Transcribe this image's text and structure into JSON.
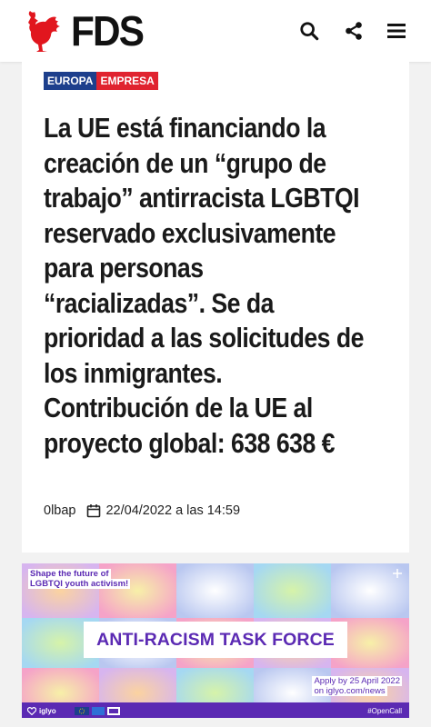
{
  "header": {
    "logo_text": "FDS",
    "icons": [
      "rooster-logo-icon",
      "search-icon",
      "share-icon",
      "menu-icon"
    ]
  },
  "article": {
    "tags": [
      "EUROPA",
      "EMPRESA"
    ],
    "headline_lines": [
      "La UE está financiando la",
      "creación de un “grupo de",
      "trabajo” antirracista LGBTQI",
      "reservado exclusivamente",
      "para personas",
      "“racializadas”. Se da",
      "prioridad a las solicitudes de",
      "los inmigrantes.",
      "Contribución de la UE al",
      "proyecto global: 638 638 €"
    ],
    "author": "0lbap",
    "date": "22/04/2022 a las 14:59"
  },
  "banner": {
    "top_left_lines": [
      "Shape the future of",
      "LGBTQI youth activism!"
    ],
    "title": "ANTI-RACISM TASK FORCE",
    "apply_lines": [
      "Apply by 25 April 2022",
      "on iglyo.com/news"
    ],
    "brand": "iglyo",
    "hashtag": "#OpenCall"
  },
  "colors": {
    "tag_blue": "#1d3f8c",
    "tag_red": "#e0232f",
    "logo_red": "#e1161e",
    "banner_purple": "#5b2ab3"
  }
}
